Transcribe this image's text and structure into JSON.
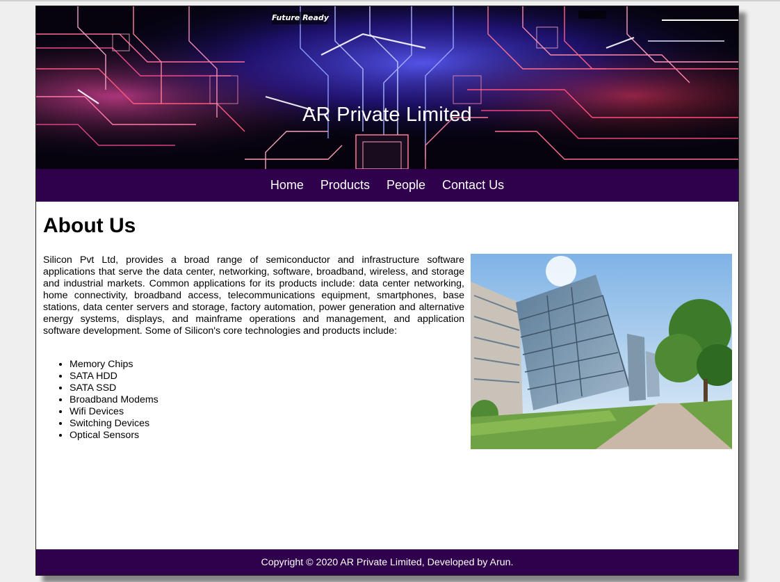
{
  "banner": {
    "title": "AR Private Limited",
    "tagline": "Future Ready"
  },
  "nav": {
    "items": [
      "Home",
      "Products",
      "People",
      "Contact Us"
    ]
  },
  "main": {
    "heading": "About Us",
    "paragraph": "Silicon Pvt Ltd, provides a broad range of semiconductor and infrastructure software applications that serve the data center, networking, software, broadband, wireless, and storage and industrial markets. Common applications for its products include: data center networking, home connectivity, broadband access, telecommunications equipment, smartphones, base stations, data center servers and storage, factory automation, power generation and alternative energy systems, displays, and mainframe operations and management, and application software development. Some of Silicon's core technologies and products include:",
    "list": [
      "Memory Chips",
      "SATA HDD",
      "SATA SSD",
      "Broadband Modems",
      "Wifi Devices",
      "Switching Devices",
      "Optical Sensors"
    ]
  },
  "footer": {
    "text": "Copyright © 2020 AR Private Limited, Developed by Arun."
  }
}
